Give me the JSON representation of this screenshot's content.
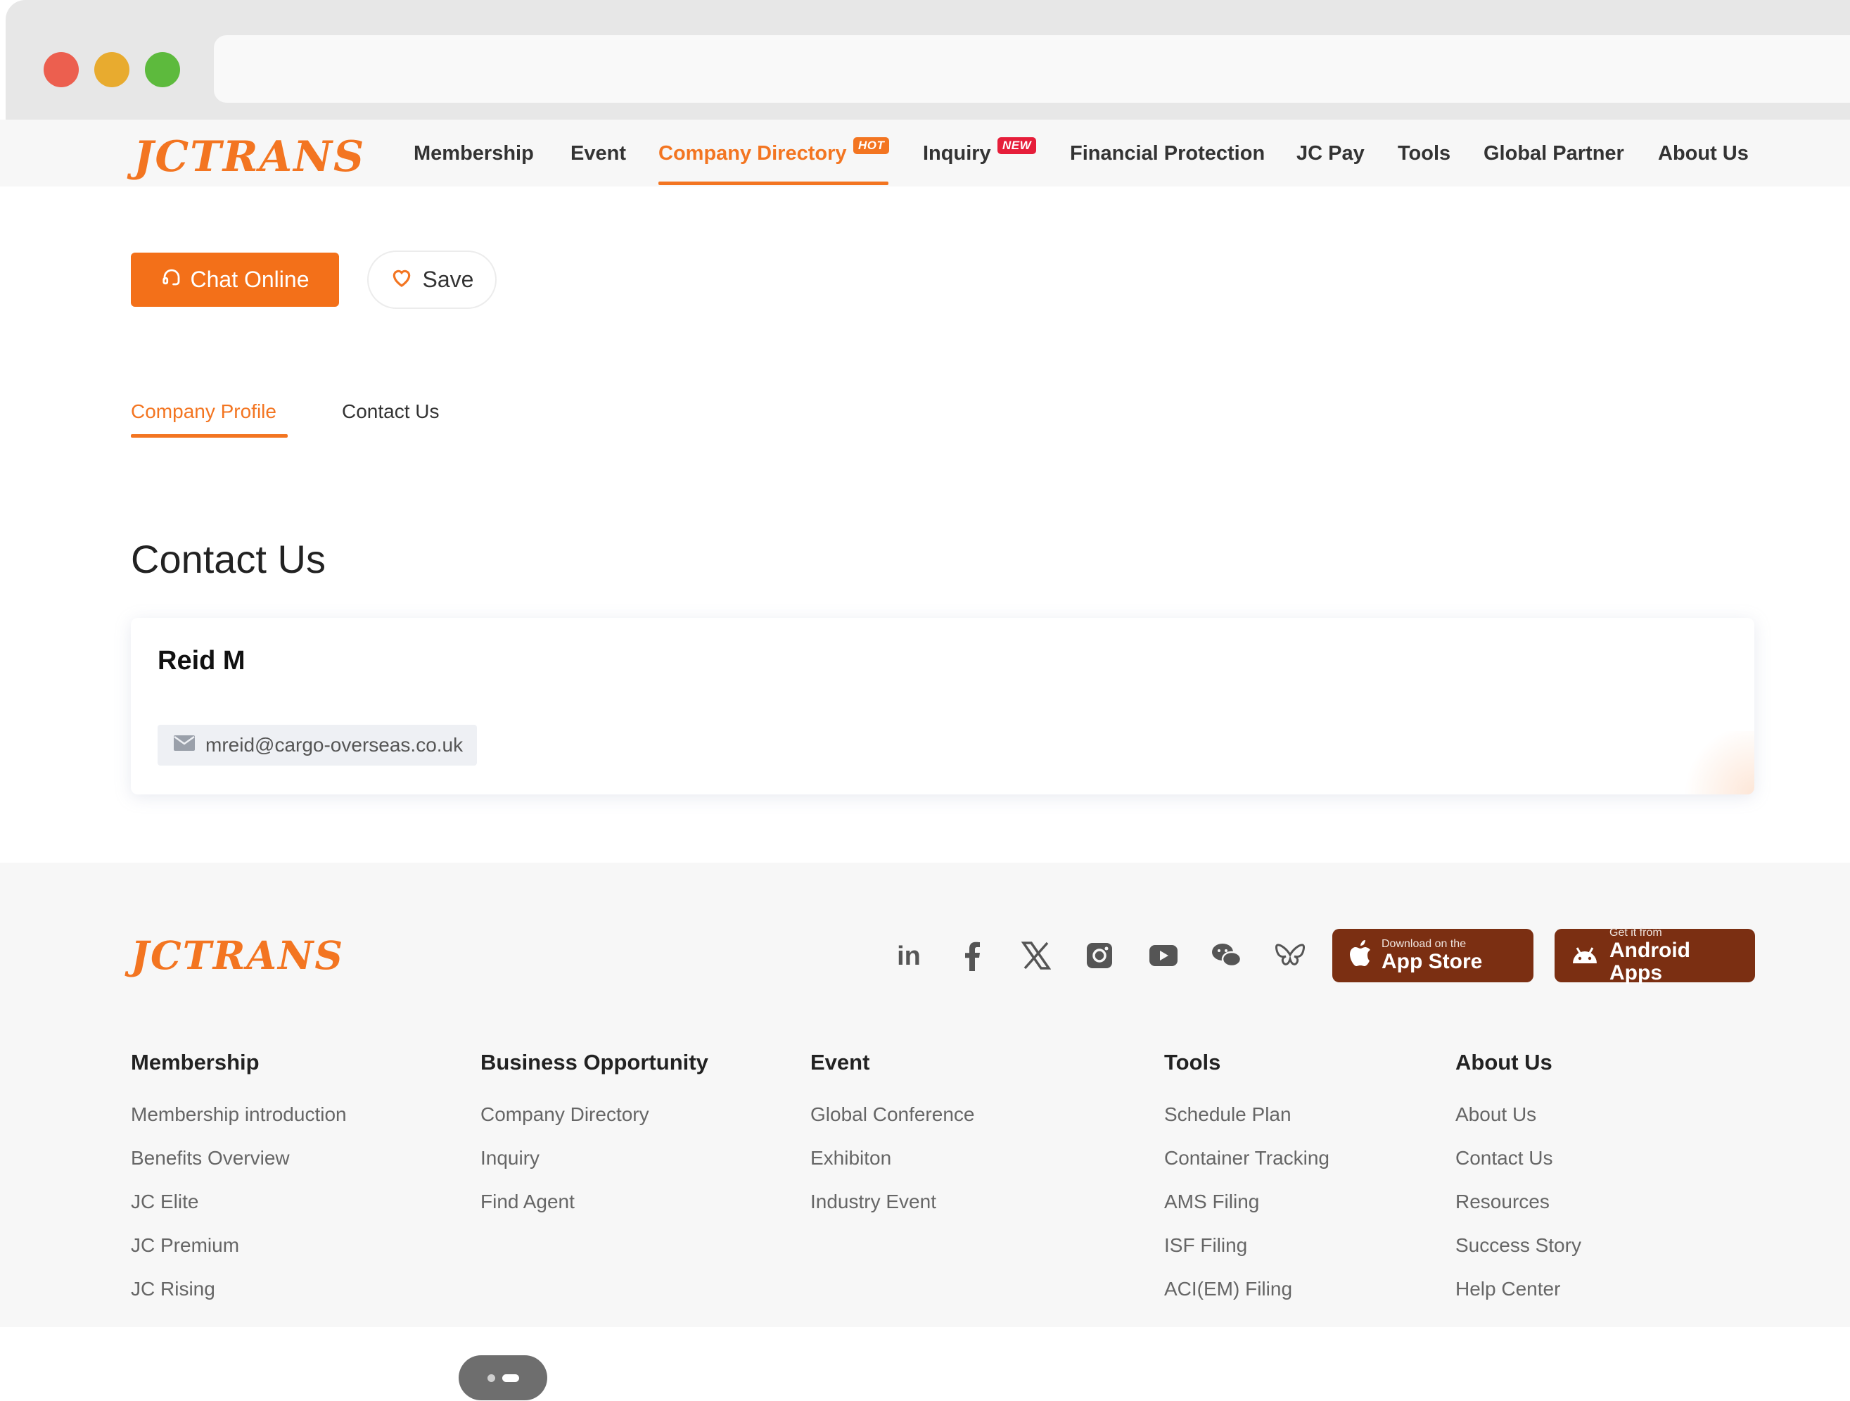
{
  "header": {
    "logo_text": "JCTRANS",
    "nav": [
      {
        "label": "Membership"
      },
      {
        "label": "Event"
      },
      {
        "label": "Company Directory",
        "badge": "HOT",
        "active": true
      },
      {
        "label": "Inquiry",
        "badge": "NEW"
      },
      {
        "label": "Financial Protection"
      },
      {
        "label": "JC Pay"
      },
      {
        "label": "Tools"
      },
      {
        "label": "Global Partner"
      },
      {
        "label": "About Us"
      }
    ],
    "accent_color": "#f37521"
  },
  "actions": {
    "chat_label": "Chat Online",
    "save_label": "Save"
  },
  "tabs": [
    {
      "label": "Company Profile",
      "active": true
    },
    {
      "label": "Contact Us",
      "active": false
    }
  ],
  "section": {
    "title": "Contact Us"
  },
  "contact": {
    "name": "Reid M",
    "email": "mreid@cargo-overseas.co.uk"
  },
  "footer": {
    "logo_text": "JCTRANS",
    "social_icons": [
      "linkedin-icon",
      "facebook-icon",
      "x-icon",
      "instagram-icon",
      "youtube-icon",
      "wechat-icon",
      "bluesky-icon"
    ],
    "app_store": {
      "small": "Download on the",
      "big": "App Store"
    },
    "android": {
      "small": "Get it from",
      "big": "Android Apps"
    },
    "store_color": "#7b2f12",
    "columns": [
      {
        "heading": "Membership",
        "links": [
          "Membership introduction",
          "Benefits Overview",
          "JC Elite",
          "JC Premium",
          "JC Rising"
        ]
      },
      {
        "heading": "Business Opportunity",
        "links": [
          "Company Directory",
          "Inquiry",
          "Find Agent"
        ]
      },
      {
        "heading": "Event",
        "links": [
          "Global Conference",
          "Exhibiton",
          "Industry Event"
        ]
      },
      {
        "heading": "Tools",
        "links": [
          "Schedule Plan",
          "Container Tracking",
          "AMS Filing",
          "ISF Filing",
          "ACI(EM) Filing"
        ]
      },
      {
        "heading": "About Us",
        "links": [
          "About Us",
          "Contact Us",
          "Resources",
          "Success Story",
          "Help Center"
        ]
      }
    ]
  }
}
